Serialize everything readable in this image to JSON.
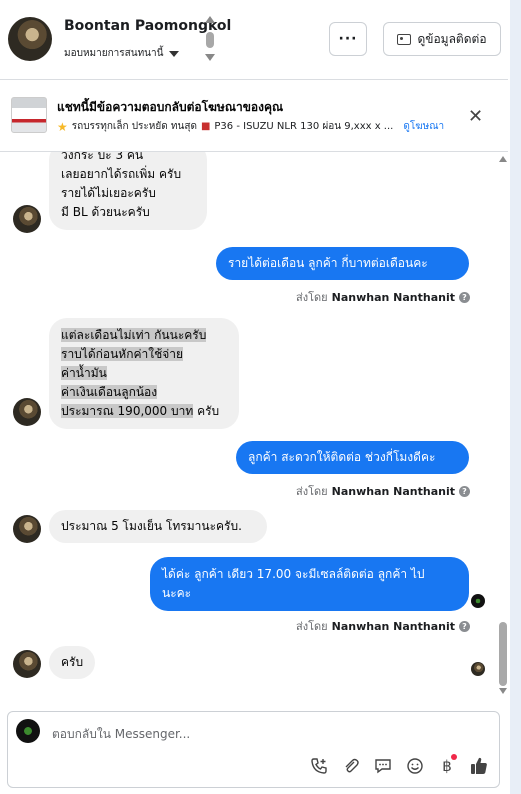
{
  "header": {
    "user_name": "Boontan Paomongkol",
    "assign_label": "มอบหมายการสนทนานี้",
    "more_label": "···",
    "contact_info_label": "ดูข้อมูลติดต่อ"
  },
  "ad_banner": {
    "title": "แชทนี้มีข้อความตอบกลับต่อโฆษณาของคุณ",
    "subtitle": "รถบรรทุกเล็ก ประหยัด ทนสุด",
    "subtitle_detail": "P36 - ISUZU NLR 130 ผ่อน 9,xxx x ...",
    "link_label": "ดูโฆษณา"
  },
  "messages": {
    "m1": [
      "วิงกระ บะ 3 คัน",
      "เลยอยากได้รถเพิ่ม ครับ",
      " รายได้ไม่เยอะครับ",
      "มี BL ด้วยนะครับ"
    ],
    "m2": "รายได้ต่อเดือน  ลูกค้า กี่บาทต่อเดือนคะ",
    "m3": [
      "แต่ละเดือนไม่เท่า กันนะครับ",
      "ราบได้ก่อนหักค่าใช้จ่าย",
      "ค่าน้ำมัน",
      "ค่าเงินเดือนลูกน้อง",
      "ประมารณ 190,000 บาท",
      " ครับ"
    ],
    "m4": "ลูกค้า สะดวกให้ติดต่อ ช่วงกี่โมงดีคะ",
    "m5": "ประมาณ 5 โมงเย็น โทรมานะครับ.",
    "m6": [
      "ได้ค่ะ  ลูกค้า เดียว 17.00 จะมีเซลล์ติดต่อ ลูกค้า ไป",
      "นะคะ"
    ],
    "m7": "ครับ",
    "sent_by_prefix": "ส่งโดย",
    "sent_by_name": "Nanwhan Nanthanit",
    "help": "?"
  },
  "composer": {
    "placeholder": "ตอบกลับใน Messenger..."
  },
  "icons": {
    "tools": [
      "phone-plus-icon",
      "paperclip-icon",
      "saved-reply-icon",
      "emoji-icon",
      "baht-icon",
      "like-icon"
    ]
  },
  "colors": {
    "accent": "#1877f2",
    "incoming_bubble": "#f0f0f0",
    "highlight": "#c8c8c8"
  }
}
